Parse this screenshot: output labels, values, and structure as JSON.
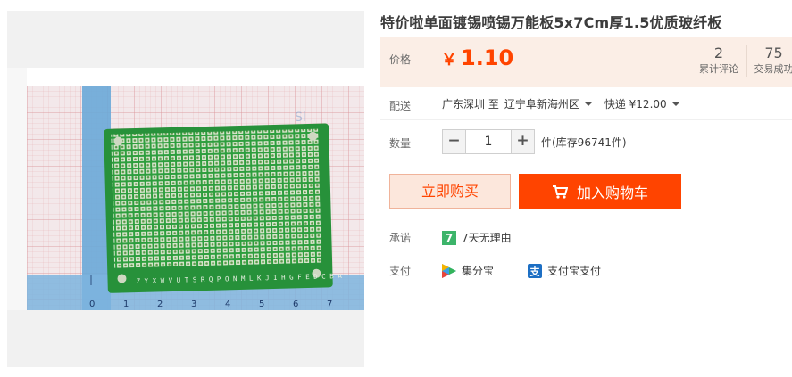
{
  "product": {
    "title": "特价啦单面镀锡喷锡万能板5x7Cm厚1.5优质玻纤板"
  },
  "price": {
    "label": "价格",
    "currency": "￥",
    "value": "1.10",
    "color": "#ff4400"
  },
  "stats": {
    "reviews_count": "2",
    "reviews_label": "累计评论",
    "sales_count": "75",
    "sales_label": "交易成功"
  },
  "shipping": {
    "label": "配送",
    "from": "广东深圳 至",
    "to": "辽宁阜新海州区",
    "method": "快递 ¥12.00"
  },
  "quantity": {
    "label": "数量",
    "minus": "−",
    "value": "1",
    "plus": "+",
    "stock_text": "件(库存96741件)"
  },
  "actions": {
    "buy_now": "立即购买",
    "add_to_cart": "加入购物车"
  },
  "promise": {
    "label": "承诺",
    "badge": "7",
    "text": "7天无理由"
  },
  "payment": {
    "label": "支付",
    "method1": "集分宝",
    "method2": "支付宝支付"
  },
  "photo_ruler_letters": "Z Y X W V U T S R Q P O N M L K J I H G F E D C B A",
  "icons": [
    "cart-icon",
    "jifenbao-icon",
    "alipay-icon",
    "caret-down-icon"
  ]
}
